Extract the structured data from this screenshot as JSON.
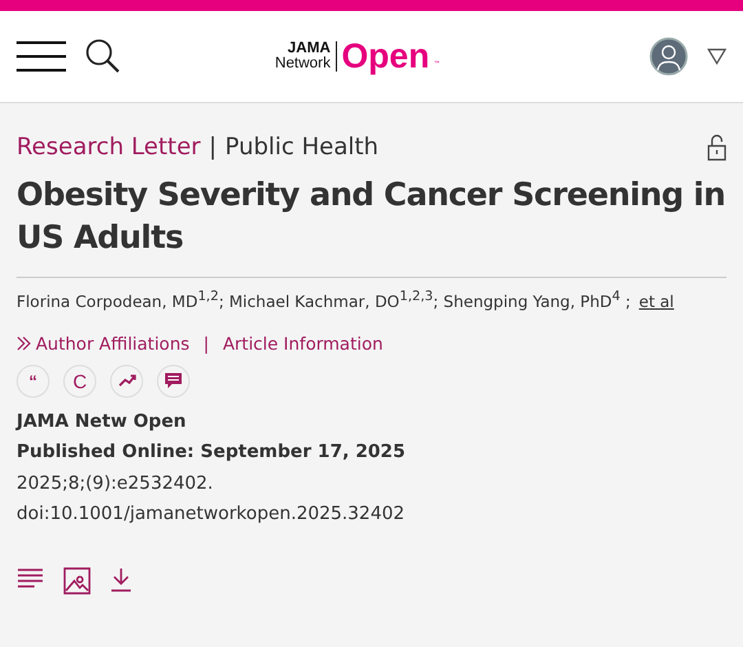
{
  "header": {
    "logo": {
      "line_1": "JAMA",
      "line_2": "Network",
      "word": "Open",
      "mark": "™"
    }
  },
  "article": {
    "type": "Research Letter",
    "separator": "|",
    "section": "Public Health",
    "title": "Obesity Severity and Cancer Screening in US Adults",
    "authors": "Florina Corpodean, MD$^{1,2}$; Michael Kachmar, DO$^{1,2,3}$; Shengping Yang, PhD$^{4}$ ;",
    "et_al": "et al",
    "links": [
      {
        "label": "Author Affiliations",
        "kind": "expand"
      },
      {
        "label": "Article Information",
        "kind": "plain"
      }
    ],
    "links_separator": "|",
    "actions": [
      {
        "kind": "quote",
        "label": "“"
      },
      {
        "kind": "c",
        "label": "C"
      },
      {
        "kind": "trend"
      },
      {
        "kind": "comment"
      }
    ],
    "journal": "JAMA Netw Open",
    "published": "Published Online: September 17, 2025",
    "citation": "2025;8;(9):e2532402.",
    "doi": "doi:10.1001/jamanetworkopen.2025.32402",
    "tools": [
      {
        "kind": "text"
      },
      {
        "kind": "figure"
      },
      {
        "kind": "download"
      }
    ]
  }
}
